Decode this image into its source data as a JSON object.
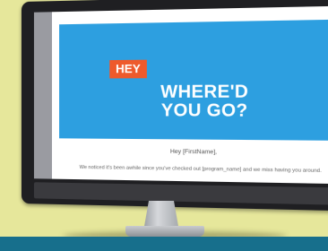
{
  "email": {
    "badge": "HEY",
    "headline_line1": "WHERE'D",
    "headline_line2": "YOU GO?",
    "greeting": "Hey [FirstName],",
    "body": "We noticed it's been awhile since you've checked out [program_name] and we miss having you around."
  },
  "colors": {
    "background": "#e6e79b",
    "hero": "#2d9fe0",
    "badge": "#ee5a2c",
    "band": "#176f8c"
  }
}
